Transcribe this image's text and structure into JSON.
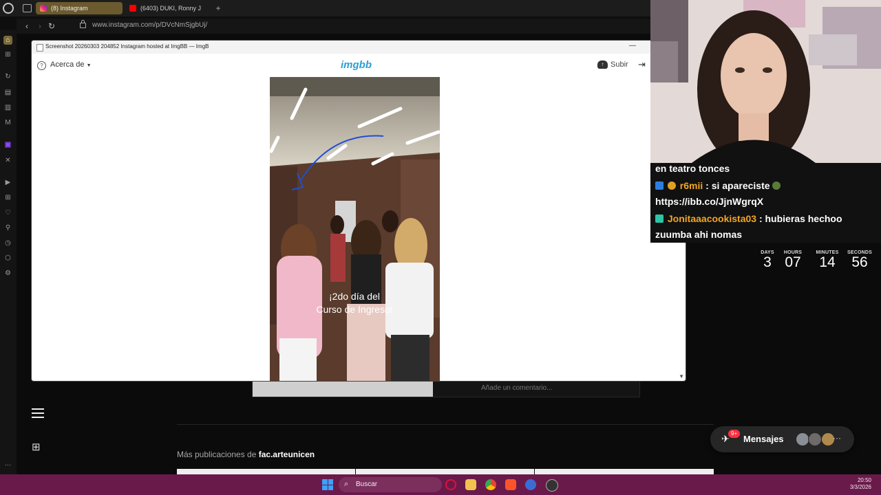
{
  "browser": {
    "tabs": [
      {
        "label": "(8) Instagram",
        "active": true
      },
      {
        "label": "(6403) DUKI, Ronny J",
        "active": false
      }
    ],
    "url": "www.instagram.com/p/DVcNmSjgbUj/"
  },
  "popup": {
    "title": "Screenshot 20260303 204852 Instagram hosted at ImgBB — ImgB",
    "menu_label": "Acerca de",
    "logo": "imgbb",
    "upload_label": "Subir",
    "image_caption_line1": "¡2do día del",
    "image_caption_line2": "Curso de Ingreso!"
  },
  "instagram": {
    "more_posts_prefix": "Más publicaciones de",
    "more_posts_user": "fac.arteunicen",
    "comment_placeholder": "Añade un comentario...",
    "messages_label": "Mensajes",
    "messages_badge": "9+"
  },
  "chat": {
    "lines": [
      {
        "text": "en teatro tonces"
      },
      {
        "user": "r6mii",
        "text": ": si apareciste"
      },
      {
        "text": "https://ibb.co/JjnWgrqX"
      },
      {
        "user": "Jonitaaacookista03",
        "text": ": hubieras hechoo"
      },
      {
        "text": "zuumba ahi nomas"
      }
    ]
  },
  "countdown": {
    "labels": [
      "DAYS",
      "HOURS",
      "MINUTES",
      "SECONDS"
    ],
    "values": [
      "3",
      "07",
      "14",
      "56"
    ]
  },
  "taskbar": {
    "search_label": "Buscar",
    "time": "20:50",
    "date": "3/3/2026"
  },
  "colors": {
    "chat_username": "#f5a623",
    "imgbb_brand": "#2a9fd6",
    "taskbar": "#6a1a4a",
    "active_tab": "#6b5a2e"
  }
}
